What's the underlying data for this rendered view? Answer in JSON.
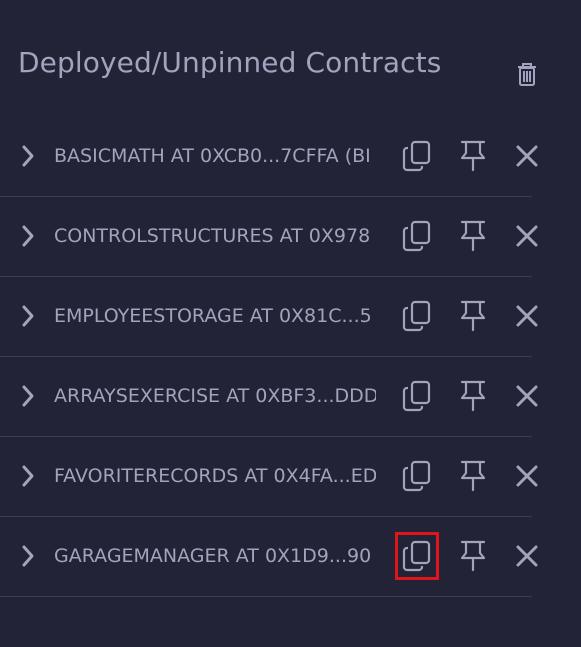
{
  "panel": {
    "title": "Deployed/Unpinned Contracts",
    "clear_icon": "trash-icon"
  },
  "contracts": [
    {
      "label": "BASICMATH AT 0XCB0...7CFFA (BI",
      "expand_icon": "chevron-right-icon",
      "copy_icon": "copy-icon",
      "pin_icon": "pin-icon",
      "remove_icon": "close-icon"
    },
    {
      "label": "CONTROLSTRUCTURES AT 0X978",
      "expand_icon": "chevron-right-icon",
      "copy_icon": "copy-icon",
      "pin_icon": "pin-icon",
      "remove_icon": "close-icon"
    },
    {
      "label": "EMPLOYEESTORAGE AT 0X81C...5",
      "expand_icon": "chevron-right-icon",
      "copy_icon": "copy-icon",
      "pin_icon": "pin-icon",
      "remove_icon": "close-icon"
    },
    {
      "label": "ARRAYSEXERCISE AT 0XBF3...DDD",
      "expand_icon": "chevron-right-icon",
      "copy_icon": "copy-icon",
      "pin_icon": "pin-icon",
      "remove_icon": "close-icon"
    },
    {
      "label": "FAVORITERECORDS AT 0X4FA...ED",
      "expand_icon": "chevron-right-icon",
      "copy_icon": "copy-icon",
      "pin_icon": "pin-icon",
      "remove_icon": "close-icon"
    },
    {
      "label": "GARAGEMANAGER AT 0X1D9...90",
      "expand_icon": "chevron-right-icon",
      "copy_icon": "copy-icon",
      "pin_icon": "pin-icon",
      "remove_icon": "close-icon",
      "copy_highlighted": true
    }
  ],
  "colors": {
    "background": "#222336",
    "text": "#a2a3bd",
    "divider": "#3b3c55",
    "highlight": "#e0141b"
  }
}
